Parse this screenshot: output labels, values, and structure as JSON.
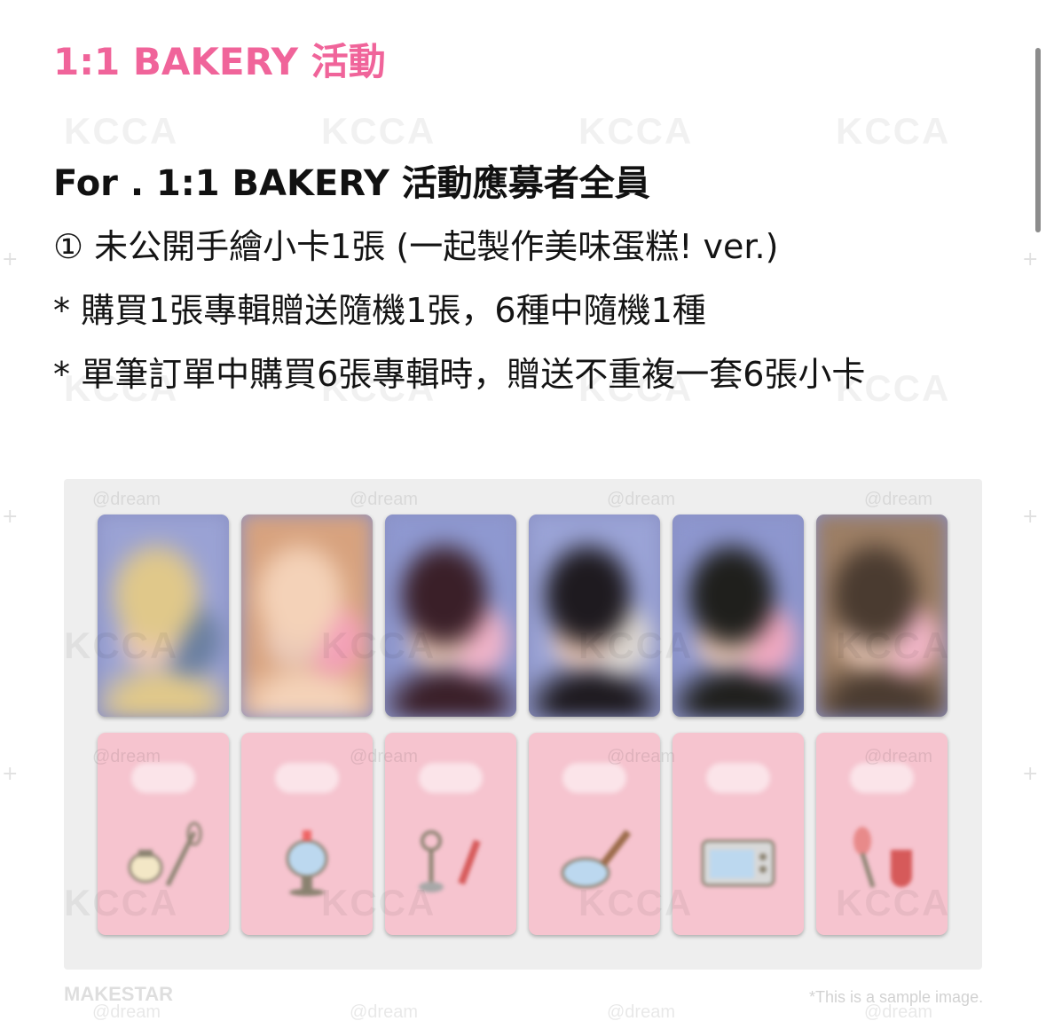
{
  "title": "1:1 BAKERY 活動",
  "headline": "For . 1:1 BAKERY 活動應募者全員",
  "bullets": [
    "① 未公開手繪小卡1張 (一起製作美味蛋糕! ver.)",
    "* 購買1張專輯贈送隨機1張，6種中隨機1種",
    "* 單筆訂單中購買6張專輯時，贈送不重複一套6張小卡"
  ],
  "watermark": {
    "brand": "KCCA",
    "handle": "@dream"
  },
  "footer": {
    "brand": "MAKESTAR",
    "note": "*This is a sample image."
  },
  "photocards": [
    {
      "name": "photocard-1",
      "colors": [
        "#9aa2d4",
        "#e0c88a",
        "#6a7fa0"
      ]
    },
    {
      "name": "photocard-2",
      "colors": [
        "#d7a27e",
        "#f4d2b8",
        "#f3a0b8"
      ]
    },
    {
      "name": "photocard-3",
      "colors": [
        "#8e98d0",
        "#3a1f28",
        "#f0b3c8"
      ]
    },
    {
      "name": "photocard-4",
      "colors": [
        "#9aa3d6",
        "#1e1a1f",
        "#dcd6d0"
      ]
    },
    {
      "name": "photocard-5",
      "colors": [
        "#8d96ce",
        "#1f1f1c",
        "#f0a8c0"
      ]
    },
    {
      "name": "photocard-6",
      "colors": [
        "#9c7e64",
        "#4a3b30",
        "#f2b6c8"
      ]
    }
  ],
  "card_backs": [
    {
      "name": "card-back-teapot-whisk-icon"
    },
    {
      "name": "card-back-cake-stand-icon"
    },
    {
      "name": "card-back-tools-icon"
    },
    {
      "name": "card-back-bowl-spoon-icon"
    },
    {
      "name": "card-back-oven-icon"
    },
    {
      "name": "card-back-spatula-mitten-icon"
    }
  ],
  "accent_color": "#f0649a",
  "card_back_color": "#f6c4cf"
}
